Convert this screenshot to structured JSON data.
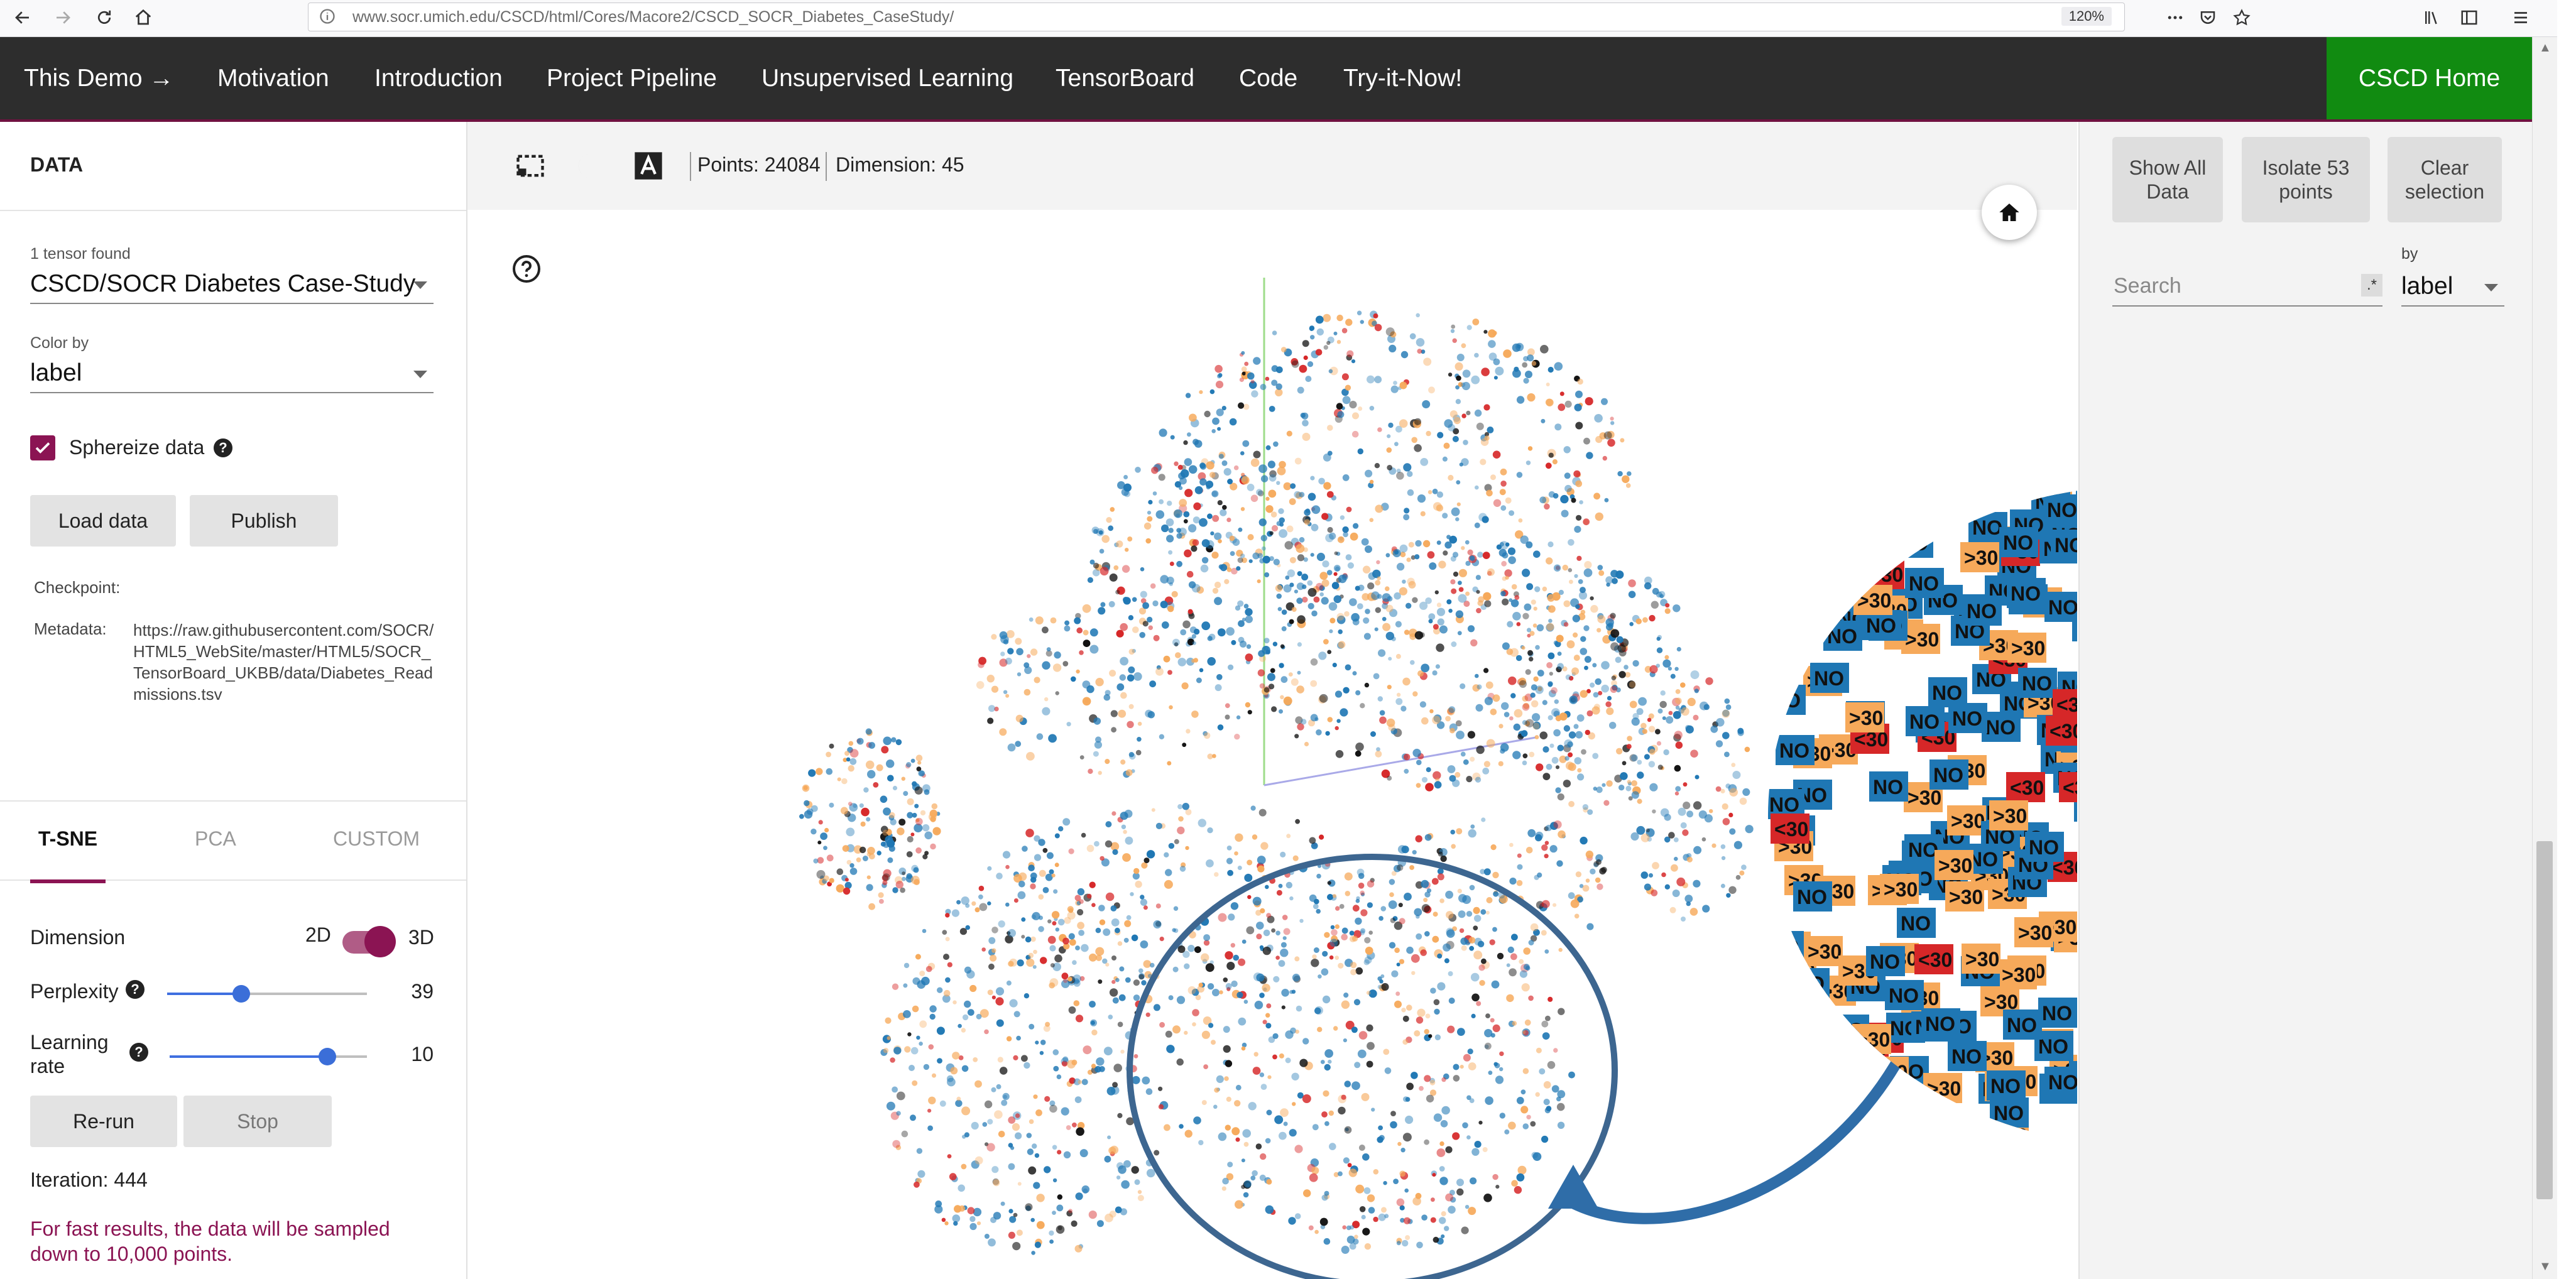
{
  "browser": {
    "url": "www.socr.umich.edu/CSCD/html/Cores/Macore2/CSCD_SOCR_Diabetes_CaseStudy/",
    "zoom": "120%",
    "icons": [
      "back-icon",
      "forward-icon",
      "reload-icon",
      "home-icon",
      "info-icon",
      "more-icon",
      "pocket-icon",
      "bookmark-star-icon",
      "library-icon",
      "sidebar-icon",
      "menu-icon"
    ]
  },
  "nav": {
    "items": [
      "This Demo →",
      "Motivation",
      "Introduction",
      "Project Pipeline",
      "Unsupervised Learning",
      "TensorBoard",
      "Code",
      "Try-it-Now!"
    ],
    "home": "CSCD Home",
    "colors": {
      "bar": "#2d2d2d",
      "home": "#118b11",
      "accent": "#8b1453"
    }
  },
  "left": {
    "title": "DATA",
    "tensor_found": "1 tensor found",
    "tensor_name": "CSCD/SOCR Diabetes Case-Study",
    "color_by_label": "Color by",
    "color_by_value": "label",
    "sphereize_label": "Sphereize data",
    "sphereize_checked": true,
    "load_button": "Load data",
    "publish_button": "Publish",
    "checkpoint_label": "Checkpoint:",
    "metadata_label": "Metadata:",
    "metadata_value": "https://raw.githubusercontent.com/SOCR/HTML5_WebSite/master/HTML5/SOCR_TensorBoard_UKBB/data/Diabetes_Readmissions.tsv",
    "tabs": [
      "T-SNE",
      "PCA",
      "CUSTOM"
    ],
    "active_tab": "T-SNE",
    "dimension_label": "Dimension",
    "dim_2d": "2D",
    "dim_3d": "3D",
    "perplexity_label": "Perplexity",
    "perplexity_value": "39",
    "perplexity_fraction": 0.37,
    "learning_rate_label": "Learning rate",
    "learning_rate_value": "10",
    "learning_rate_fraction": 0.8,
    "rerun_button": "Re-run",
    "stop_button": "Stop",
    "iteration": "Iteration: 444",
    "note": "For fast results, the data will be sampled down to 10,000 points."
  },
  "toolbar": {
    "points": "Points: 24084",
    "dimension": "Dimension: 45",
    "icons": [
      "selection-box-icon",
      "night-mode-icon",
      "label-toggle-icon"
    ]
  },
  "right": {
    "show_all": "Show All Data",
    "isolate": "Isolate 53 points",
    "clear": "Clear selection",
    "search_placeholder": "Search",
    "regex": ".*",
    "by_label": "by",
    "by_value": "label"
  },
  "scatter": {
    "label_values": [
      "NO",
      ">30",
      "<30"
    ],
    "colors": {
      "NO": "#1f77b4",
      ">30": "#f6a95a",
      "<30": "#d62728",
      "dark": "#111111"
    }
  }
}
